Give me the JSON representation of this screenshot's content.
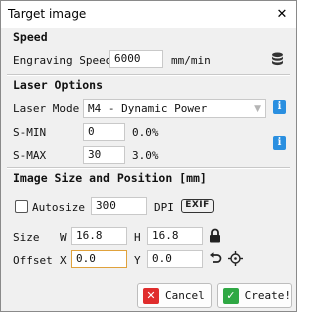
{
  "window": {
    "title": "Target image",
    "close_glyph": "✕"
  },
  "speed": {
    "header": "Speed",
    "engraving_label": "Engraving Speed",
    "engraving_value": "6000",
    "unit": "mm/min",
    "db_icon": "database-icon"
  },
  "laser": {
    "header": "Laser Options",
    "mode_label": "Laser Mode",
    "mode_value": "M4 - Dynamic Power",
    "smin_label": "S-MIN",
    "smin_value": "0",
    "smin_percent": "0.0%",
    "smax_label": "S-MAX",
    "smax_value": "30",
    "smax_percent": "3.0%",
    "info_glyph": "i"
  },
  "image": {
    "header": "Image Size and Position [mm]",
    "autosize_label": "Autosize",
    "autosize_checked": false,
    "dpi_value": "300",
    "dpi_label": "DPI",
    "exif_label": "EXIF",
    "size_label": "Size",
    "w_label": "W",
    "w_value": "16.8",
    "h_label": "H",
    "h_value": "16.8",
    "offset_label": "Offset",
    "x_label": "X",
    "x_value": "0.0",
    "y_label": "Y",
    "y_value": "0.0"
  },
  "buttons": {
    "cancel_label": "Cancel",
    "create_label": "Create!",
    "cancel_color": "#e02d2d",
    "create_color": "#2fa844"
  }
}
